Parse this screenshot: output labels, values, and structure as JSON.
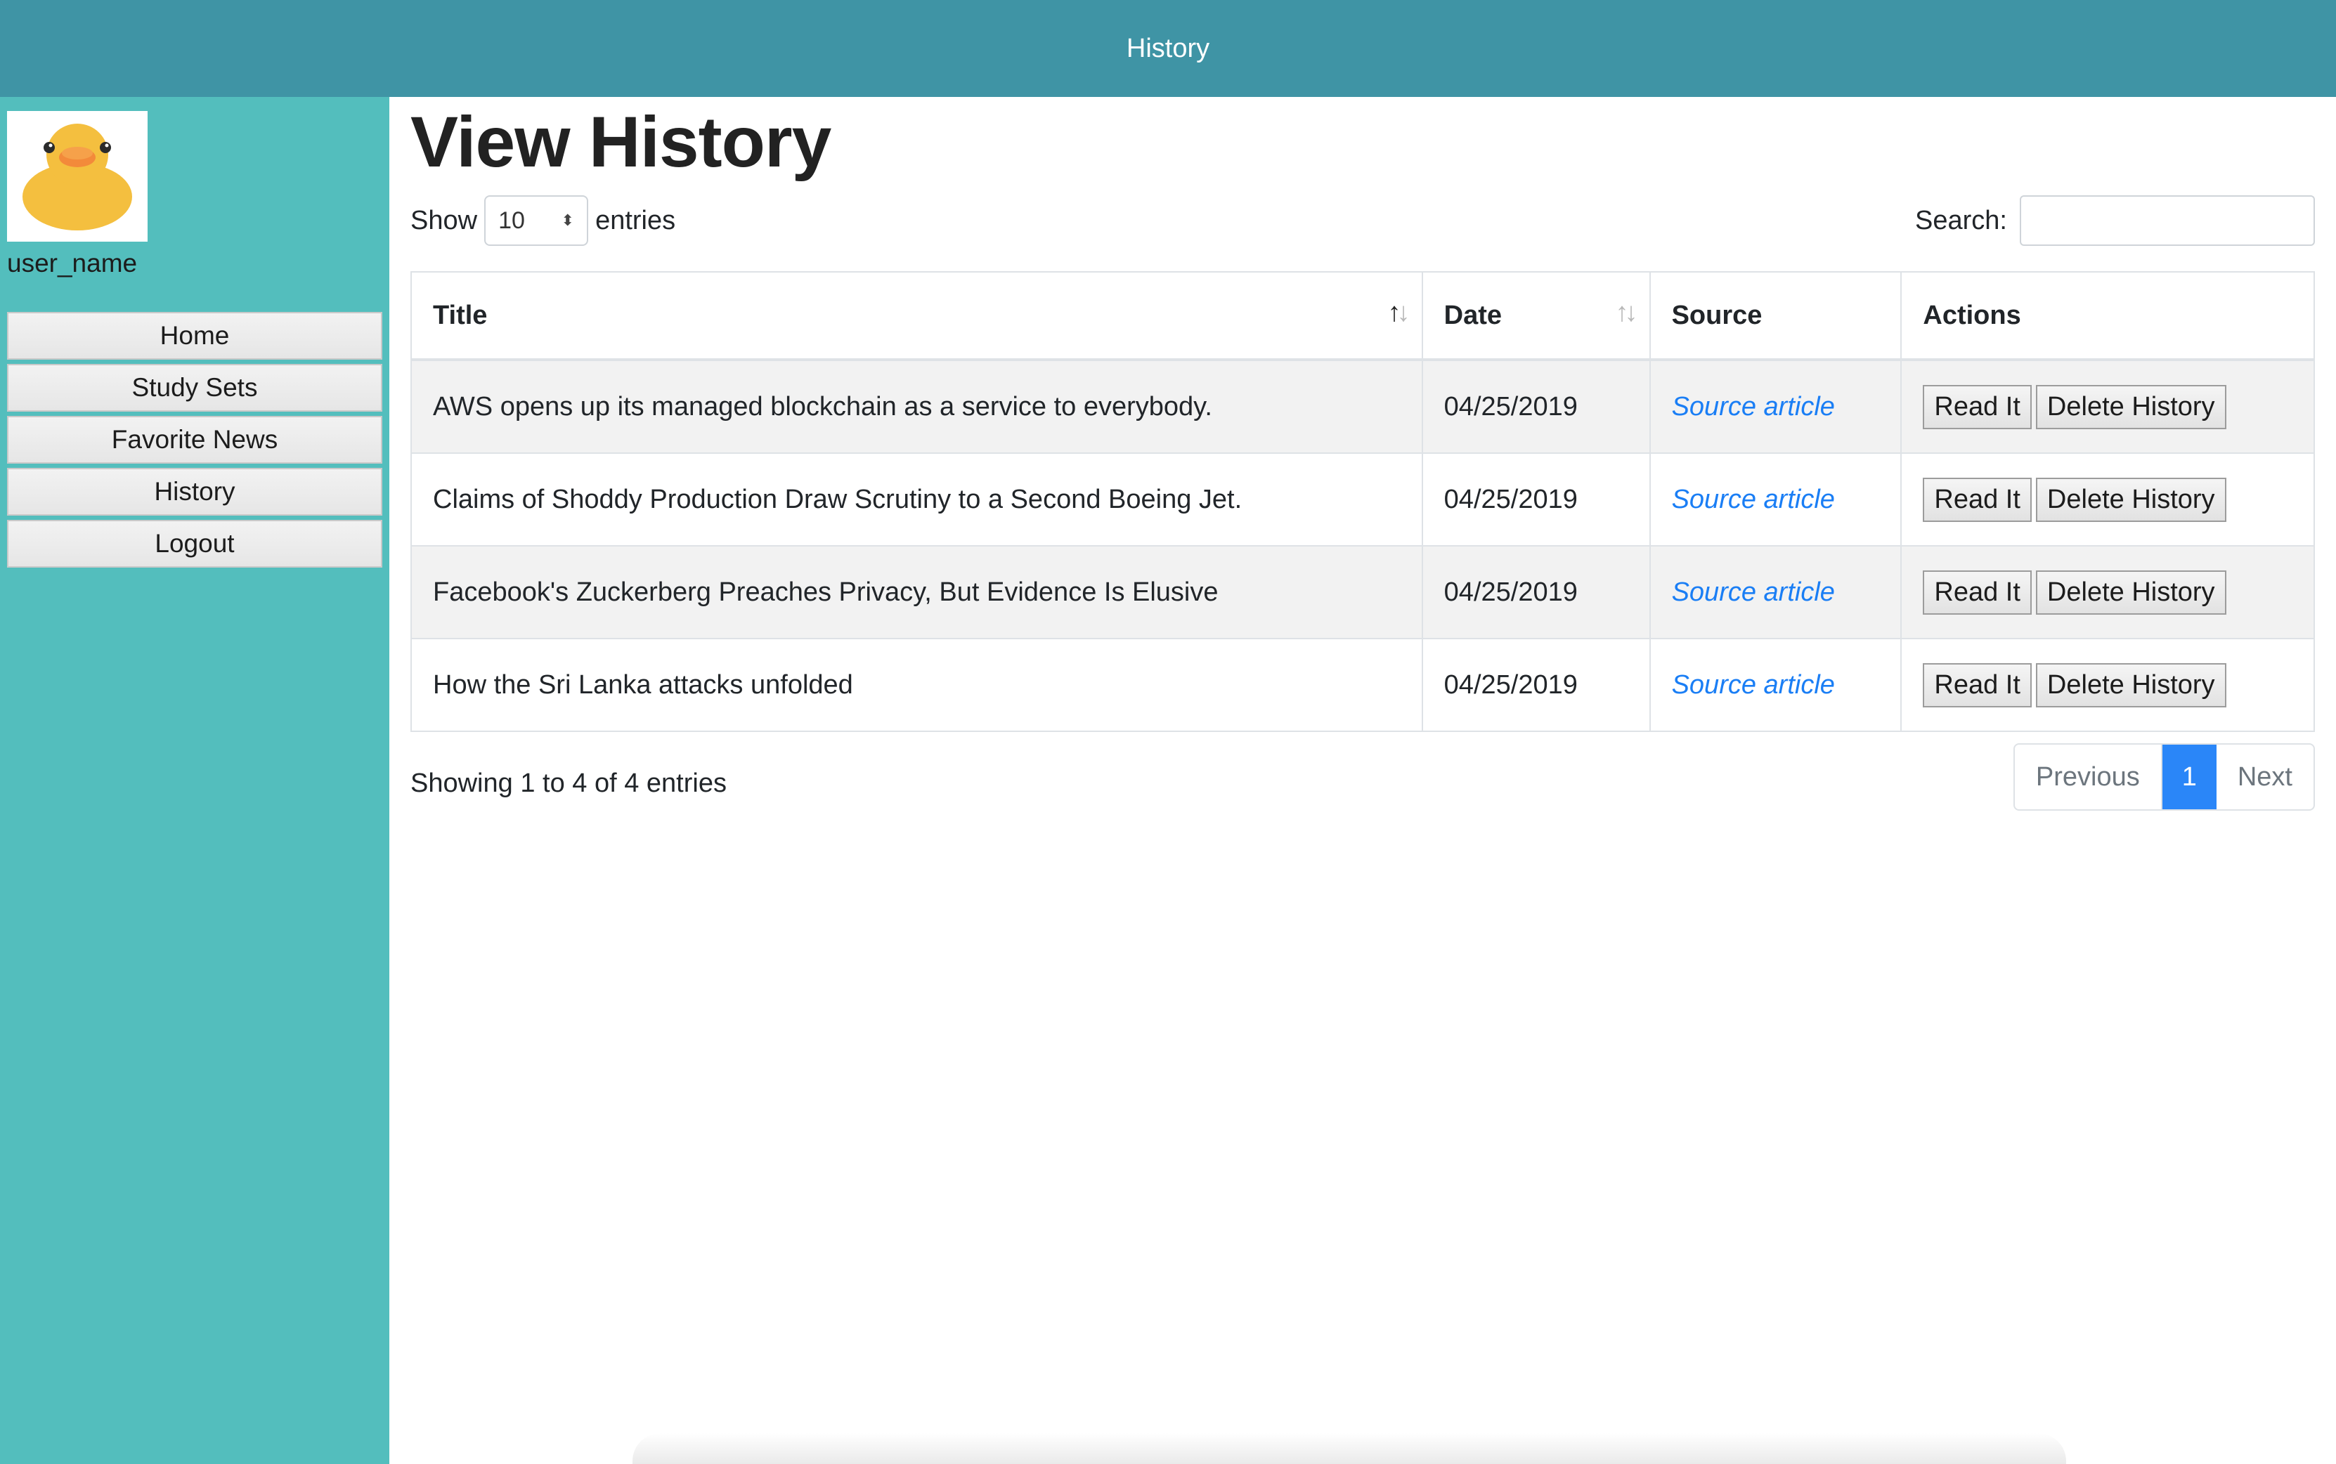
{
  "header": {
    "title": "History"
  },
  "sidebar": {
    "username": "user_name",
    "nav": [
      {
        "label": "Home",
        "name": "nav-home"
      },
      {
        "label": "Study Sets",
        "name": "nav-study-sets"
      },
      {
        "label": "Favorite News",
        "name": "nav-favorite-news"
      },
      {
        "label": "History",
        "name": "nav-history"
      },
      {
        "label": "Logout",
        "name": "nav-logout"
      }
    ]
  },
  "main": {
    "title": "View History",
    "length": {
      "prefix": "Show",
      "value": "10",
      "suffix": "entries"
    },
    "search": {
      "label": "Search:",
      "value": ""
    },
    "table": {
      "columns": [
        "Title",
        "Date",
        "Source",
        "Actions"
      ],
      "rows": [
        {
          "title": "AWS opens up its managed blockchain as a service to everybody.",
          "date": "04/25/2019",
          "source": "Source article",
          "read": "Read It",
          "delete": "Delete History"
        },
        {
          "title": "Claims of Shoddy Production Draw Scrutiny to a Second Boeing Jet.",
          "date": "04/25/2019",
          "source": "Source article",
          "read": "Read It",
          "delete": "Delete History"
        },
        {
          "title": "Facebook's Zuckerberg Preaches Privacy, But Evidence Is Elusive",
          "date": "04/25/2019",
          "source": "Source article",
          "read": "Read It",
          "delete": "Delete History"
        },
        {
          "title": "How the Sri Lanka attacks unfolded",
          "date": "04/25/2019",
          "source": "Source article",
          "read": "Read It",
          "delete": "Delete History"
        }
      ]
    },
    "info": "Showing 1 to 4 of 4 entries",
    "pagination": {
      "previous": "Previous",
      "current": "1",
      "next": "Next"
    }
  },
  "colors": {
    "header_bg": "#3f94a5",
    "sidebar_bg": "#53bebd",
    "link": "#1a7ef5",
    "page_active": "#2a86f8"
  },
  "icons": [
    "duck-avatar-icon",
    "sort-ascending-icon",
    "sort-both-icon",
    "select-caret-icon"
  ]
}
